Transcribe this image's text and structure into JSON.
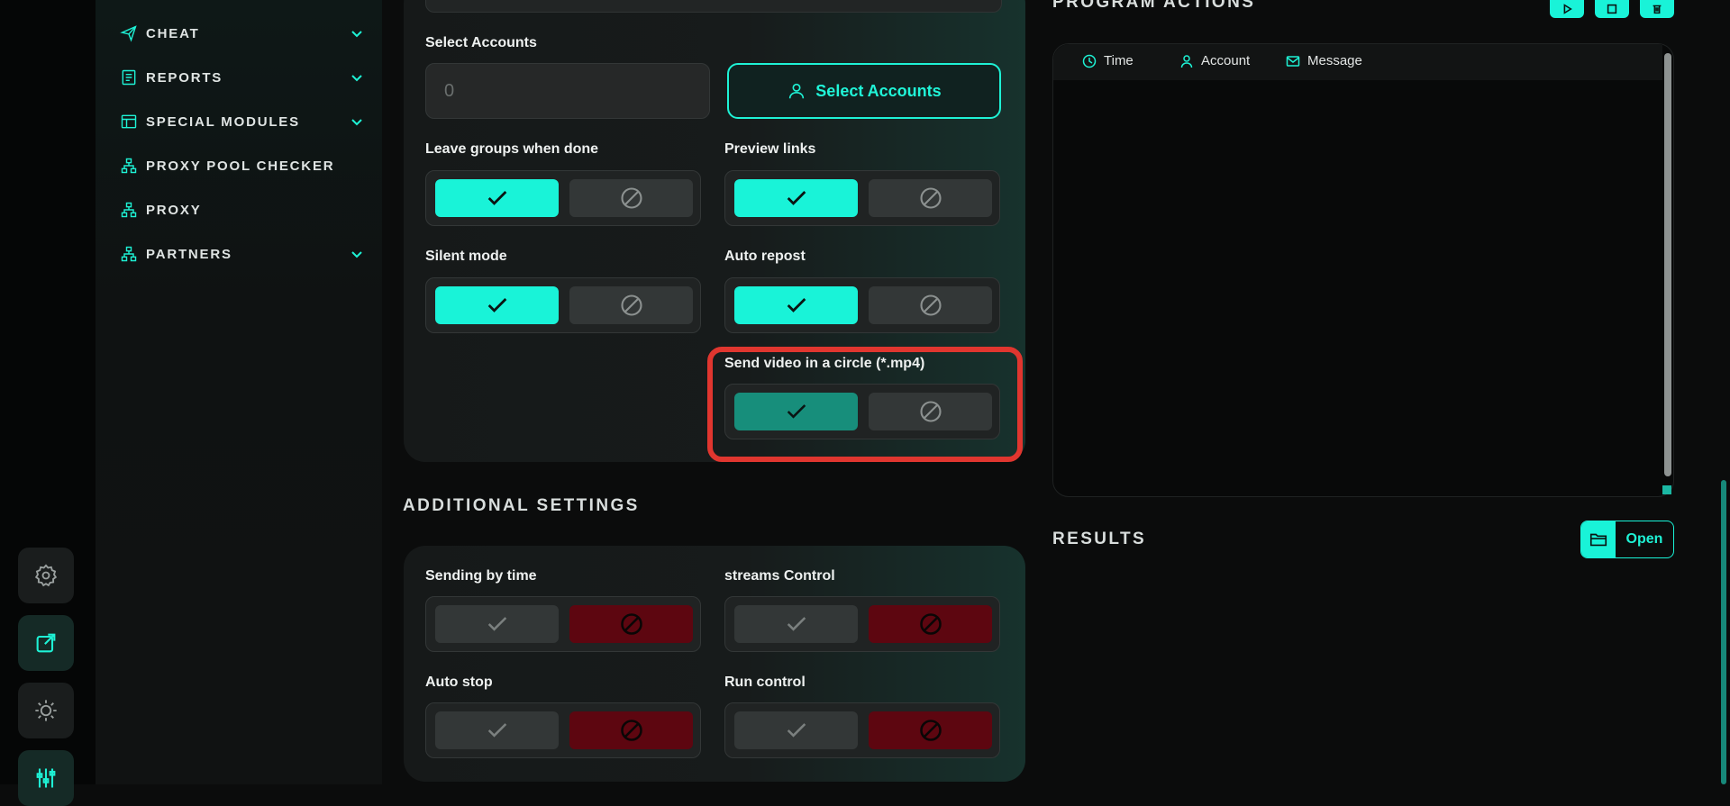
{
  "sidebar": {
    "items": [
      {
        "label": "CHEAT",
        "icon": "send-icon",
        "has_chevron": true
      },
      {
        "label": "REPORTS",
        "icon": "report-icon",
        "has_chevron": true
      },
      {
        "label": "SPECIAL MODULES",
        "icon": "module-icon",
        "has_chevron": true
      },
      {
        "label": "PROXY POOL CHECKER",
        "icon": "network-icon",
        "has_chevron": false
      },
      {
        "label": "PROXY",
        "icon": "network-icon",
        "has_chevron": false
      },
      {
        "label": "PARTNERS",
        "icon": "network-icon",
        "has_chevron": true
      }
    ]
  },
  "rail": {
    "buttons": [
      "settings-icon",
      "external-link-icon",
      "theme-icon",
      "sliders-icon"
    ]
  },
  "main": {
    "select_accounts_label": "Select Accounts",
    "accounts_count_placeholder": "0",
    "select_accounts_button": "Select Accounts",
    "toggles": {
      "leave_groups": {
        "label": "Leave groups when done",
        "value": "on"
      },
      "preview_links": {
        "label": "Preview links",
        "value": "on"
      },
      "silent_mode": {
        "label": "Silent mode",
        "value": "on"
      },
      "auto_repost": {
        "label": "Auto repost",
        "value": "on"
      },
      "send_video_circle": {
        "label": "Send video in a circle (*.mp4)",
        "value": "on"
      }
    },
    "additional_settings_title": "ADDITIONAL SETTINGS",
    "additional": {
      "sending_by_time": {
        "label": "Sending by time",
        "value": "off"
      },
      "streams_control": {
        "label": "streams Control",
        "value": "off"
      },
      "auto_stop": {
        "label": "Auto stop",
        "value": "off"
      },
      "run_control": {
        "label": "Run control",
        "value": "off"
      }
    }
  },
  "right": {
    "program_actions_title": "PROGRAM ACTIONS",
    "log_columns": {
      "time": "Time",
      "account": "Account",
      "message": "Message"
    },
    "results_title": "RESULTS",
    "open_button": "Open"
  },
  "colors": {
    "accent": "#19f3d8",
    "accent_dark": "#178e7b",
    "danger": "#5d0610",
    "highlight": "#e0362f"
  }
}
